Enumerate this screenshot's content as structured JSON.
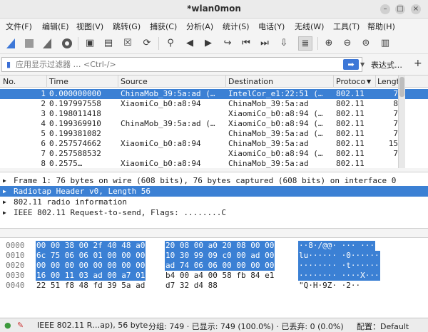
{
  "window": {
    "title": "*wlan0mon"
  },
  "menu": [
    "文件(F)",
    "编辑(E)",
    "视图(V)",
    "跳转(G)",
    "捕获(C)",
    "分析(A)",
    "统计(S)",
    "电话(Y)",
    "无线(W)",
    "工具(T)",
    "帮助(H)"
  ],
  "filter": {
    "placeholder": "应用显示过滤器 … <Ctrl-/>",
    "apply_glyph": "➡",
    "expression_label": "表达式…",
    "add_label": "+"
  },
  "columns": {
    "no": "No.",
    "time": "Time",
    "source": "Source",
    "destination": "Destination",
    "protocol": "Protoco",
    "length": "Length"
  },
  "packets": [
    {
      "no": "1",
      "time": "0.000000000",
      "source": "ChinaMob_39:5a:ad (…",
      "destination": "IntelCor_e1:22:51 (…",
      "protocol": "802.11",
      "length": "7",
      "selected": true
    },
    {
      "no": "2",
      "time": "0.197997558",
      "source": "XiaomiCo_b0:a8:94",
      "destination": "ChinaMob_39:5a:ad",
      "protocol": "802.11",
      "length": "8"
    },
    {
      "no": "3",
      "time": "0.198011418",
      "source": "",
      "destination": "XiaomiCo_b0:a8:94 (…",
      "protocol": "802.11",
      "length": "7"
    },
    {
      "no": "4",
      "time": "0.199369910",
      "source": "ChinaMob_39:5a:ad (…",
      "destination": "XiaomiCo_b0:a8:94 (…",
      "protocol": "802.11",
      "length": "7"
    },
    {
      "no": "5",
      "time": "0.199381082",
      "source": "",
      "destination": "ChinaMob_39:5a:ad (…",
      "protocol": "802.11",
      "length": "7"
    },
    {
      "no": "6",
      "time": "0.257574662",
      "source": "XiaomiCo_b0:a8:94",
      "destination": "ChinaMob_39:5a:ad",
      "protocol": "802.11",
      "length": "15"
    },
    {
      "no": "7",
      "time": "0.257588532",
      "source": "",
      "destination": "XiaomiCo_b0:a8:94 (…",
      "protocol": "802.11",
      "length": "7"
    },
    {
      "no": "8",
      "time": "0.2575…",
      "source": "XiaomiCo_b0:a8:94",
      "destination": "ChinaMob_39:5a:ad",
      "protocol": "802.11",
      "length": ""
    }
  ],
  "details": [
    {
      "arrow": "▶",
      "text": "Frame 1: 76 bytes on wire (608 bits), 76 bytes captured (608 bits) on interface 0"
    },
    {
      "arrow": "▶",
      "text": "Radiotap Header v0, Length 56",
      "selected": true
    },
    {
      "arrow": "▶",
      "text": "802.11 radio information"
    },
    {
      "arrow": "▶",
      "text": "IEEE 802.11 Request-to-send, Flags: ........C"
    }
  ],
  "hexdump": [
    {
      "offset": "0000",
      "bytes1": "00 00 38 00 2f 40 48 a0",
      "bytes2": "20 08 00 a0 20 08 00 00",
      "ascii": "··8·/@@·  ··· ···",
      "h1": true,
      "h2": true,
      "ha": true
    },
    {
      "offset": "0010",
      "bytes1": "6c 75 06 06 01 00 00 00",
      "bytes2": "10 30 99 09 c0 00 ad 00",
      "ascii": "lu······ ·0······",
      "h1": true,
      "h2": true,
      "ha": true
    },
    {
      "offset": "0020",
      "bytes1": "00 00 00 00 00 00 00 00",
      "bytes2": "ad 74 06 06 00 00 00 00",
      "ascii": "········ ·t······",
      "h1": true,
      "h2": true,
      "ha": true
    },
    {
      "offset": "0030",
      "bytes1": "16 00 11 03 ad 00 a7 01",
      "bytes2": "b4 00 a4 00 58 fb 84 e1",
      "ascii": "········ ····X···",
      "h1": true,
      "h2": false,
      "ha": true
    },
    {
      "offset": "0040",
      "bytes1": "22 51 f8 48 fd 39 5a ad",
      "bytes2": "d7 32 d4 88",
      "ascii": "\"Q·H·9Z· ·2··",
      "h1": false,
      "h2": false,
      "ha": false
    }
  ],
  "status": {
    "info": "IEEE 802.11 R…ap), 56 byte",
    "packets": "分组: 749 · 已显示: 749 (100.0%) · 已丢弃: 0 (0.0%)",
    "profile": "配置：Default"
  }
}
